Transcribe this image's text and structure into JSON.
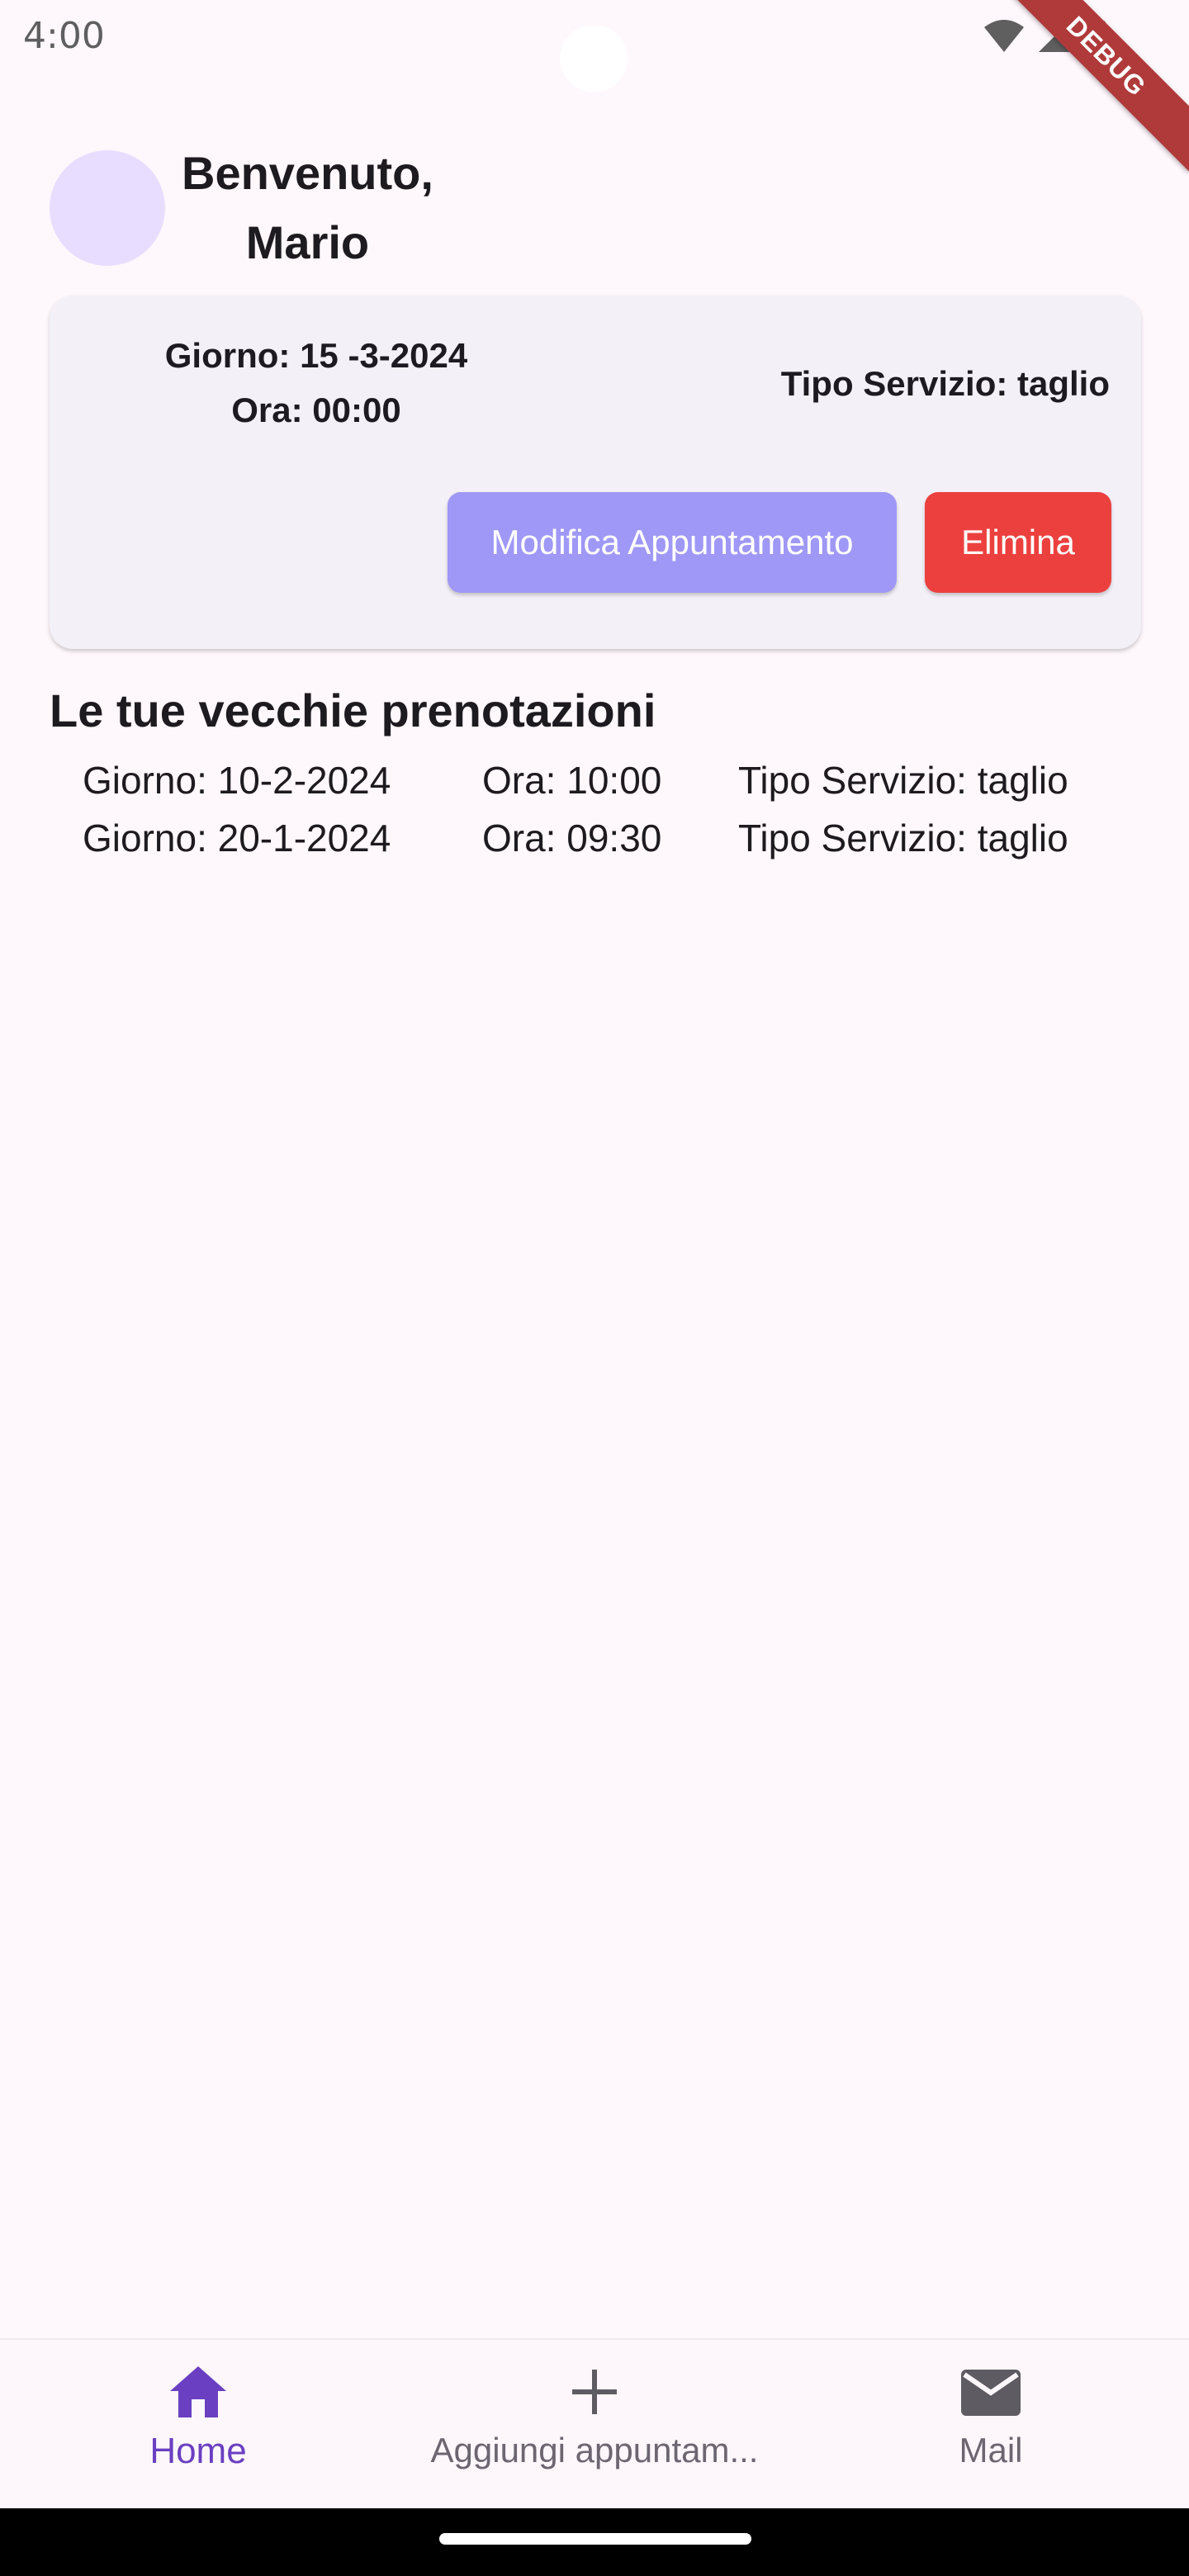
{
  "status_bar": {
    "time": "4:00",
    "debug_label": "DEBUG"
  },
  "header": {
    "greeting_line1": "Benvenuto,",
    "greeting_line2": "Mario"
  },
  "appointment": {
    "date_text": "Giorno: 15 -3-2024",
    "time_text": "Ora: 00:00",
    "service_text": "Tipo Servizio: taglio",
    "modify_label": "Modifica Appuntamento",
    "delete_label": "Elimina"
  },
  "history": {
    "title": "Le tue vecchie prenotazioni",
    "rows": [
      {
        "date": "Giorno: 10-2-2024",
        "time": "Ora: 10:00",
        "service": "Tipo Servizio: taglio"
      },
      {
        "date": "Giorno: 20-1-2024",
        "time": "Ora: 09:30",
        "service": "Tipo Servizio: taglio"
      }
    ]
  },
  "bottom_nav": {
    "items": [
      {
        "label": "Home",
        "icon": "home-icon",
        "active": true
      },
      {
        "label": "Aggiungi appuntam...",
        "icon": "plus-icon",
        "active": false
      },
      {
        "label": "Mail",
        "icon": "mail-icon",
        "active": false
      }
    ]
  },
  "colors": {
    "background": "#fef7fb",
    "accent": "#6a3fc1",
    "modify_button": "#9f98f6",
    "delete_button": "#ec403f",
    "avatar": "#e9ddff",
    "card": "#f4f0f8"
  }
}
